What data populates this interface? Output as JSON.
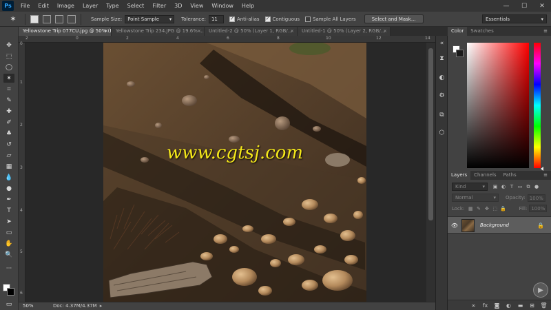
{
  "app": {
    "logo": "Ps"
  },
  "menu": [
    "File",
    "Edit",
    "Image",
    "Layer",
    "Type",
    "Select",
    "Filter",
    "3D",
    "View",
    "Window",
    "Help"
  ],
  "window_controls": {
    "minimize": "—",
    "maximize": "☐",
    "close": "✕"
  },
  "options": {
    "sample_size_label": "Sample Size:",
    "sample_size_value": "Point Sample",
    "tolerance_label": "Tolerance:",
    "tolerance_value": "11",
    "anti_alias_label": "Anti-alias",
    "contiguous_label": "Contiguous",
    "sample_all_layers_label": "Sample All Layers",
    "select_and_mask_label": "Select and Mask...",
    "workspace": "Essentials"
  },
  "tabs": [
    {
      "label": "Yellowstone Trip 077CU.jpg @ 50% (RGB/8)",
      "close": "×"
    },
    {
      "label": "Yellowstone Trip 234.JPG @ 19.6% ...",
      "close": "×"
    },
    {
      "label": "Untitled-2 @ 50% (Layer 1, RGB/...",
      "close": "×"
    },
    {
      "label": "Untitled-1 @ 50% (Layer 2, RGB/...",
      "close": "×"
    }
  ],
  "ruler_top": [
    "2",
    "0",
    "2",
    "4",
    "6",
    "8",
    "10",
    "12",
    "14"
  ],
  "ruler_left": [
    "0",
    "1",
    "2",
    "3",
    "4",
    "5",
    "6"
  ],
  "canvas": {
    "watermark": "www.cgtsj.com"
  },
  "status": {
    "zoom": "50%",
    "doc": "Doc: 4.37M/4.37M",
    "arrow": "▸"
  },
  "color_panel": {
    "tabs": [
      "Color",
      "Swatches"
    ],
    "menu": "≡"
  },
  "layers_panel": {
    "tabs": [
      "Layers",
      "Channels",
      "Paths"
    ],
    "menu": "≡",
    "kind_label": "Kind",
    "blend_mode": "Normal",
    "opacity_label": "Opacity:",
    "opacity_value": "100%",
    "lock_label": "Lock:",
    "fill_label": "Fill:",
    "fill_value": "100%",
    "layers": [
      {
        "name": "Background",
        "locked": true,
        "visible": true
      }
    ]
  }
}
